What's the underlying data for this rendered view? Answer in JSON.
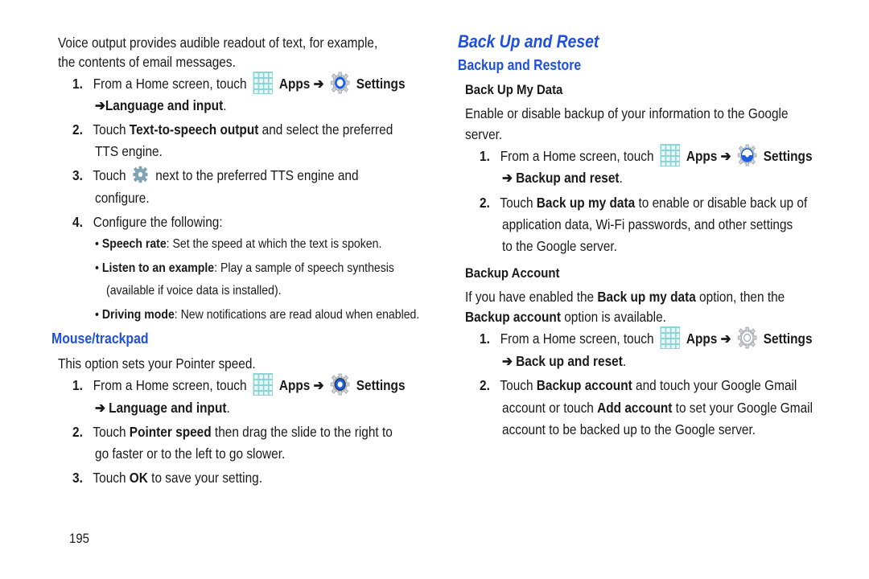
{
  "left": {
    "intro_line1": "Voice output provides audible readout of text, for example,",
    "intro_line2": "the contents of email messages.",
    "steps_a": [
      {
        "num": "1.",
        "pre": "From a Home screen, touch",
        "apps": "Apps",
        "arrow": "➔",
        "settings": "Settings",
        "line2": "➔Language and input",
        "line2_end": "."
      },
      {
        "num": "2.",
        "pre": "Touch ",
        "bold": "Text-to-speech output",
        "post": " and select the preferred",
        "line2": "TTS engine."
      },
      {
        "num": "3.",
        "pre": "Touch",
        "post": "next to the preferred TTS engine and",
        "line2": "configure."
      },
      {
        "num": "4.",
        "text": "Configure the following:"
      }
    ],
    "bullets": [
      {
        "bold": "Speech rate",
        "text": ": Set the speed at which the text is spoken."
      },
      {
        "bold": "Listen to an example",
        "text": ": Play a sample of speech synthesis",
        "line2": "(available if voice data is installed)."
      },
      {
        "bold": "Driving mode",
        "text": ": New notifications are read aloud when enabled."
      }
    ],
    "mouse_heading": "Mouse/trackpad",
    "mouse_intro": "This option sets your Pointer speed.",
    "steps_b": [
      {
        "num": "1.",
        "pre": "From a Home screen, touch",
        "apps": "Apps",
        "arrow": "➔",
        "settings": "Settings",
        "line2": "➔ Language and input",
        "line2_end": "."
      },
      {
        "num": "2.",
        "pre": "Touch ",
        "bold": "Pointer speed",
        "post": " then drag the slide to the right to",
        "line2": "go faster or to the left to go slower."
      },
      {
        "num": "3.",
        "pre": "Touch ",
        "bold": "OK",
        "post": " to save your setting."
      }
    ],
    "page_number": "195"
  },
  "right": {
    "heading": "Back Up and Reset",
    "subheading": "Backup and Restore",
    "section1_title": "Back Up My Data",
    "section1_intro_line1": "Enable or disable backup of your information to the Google",
    "section1_intro_line2": "server.",
    "steps_c": [
      {
        "num": "1.",
        "pre": "From a Home screen, touch",
        "apps": "Apps",
        "arrow": "➔",
        "settings": "Settings",
        "line2": "➔ Backup and reset",
        "line2_end": "."
      },
      {
        "num": "2.",
        "pre": "Touch ",
        "bold": "Back up my data",
        "post": " to enable or disable back up of",
        "line2": "application data, Wi-Fi passwords, and other settings",
        "line3": "to the Google server."
      }
    ],
    "section2_title": "Backup Account",
    "section2_pre": "If you have enabled the ",
    "section2_bold1": "Back up my data",
    "section2_post1": " option, then the",
    "section2_bold2": "Backup account",
    "section2_post2": " option is available.",
    "steps_d": [
      {
        "num": "1.",
        "pre": "From a Home screen, touch",
        "apps": "Apps",
        "arrow": "➔",
        "settings": "Settings",
        "line2": "➔ Back up and reset",
        "line2_end": "."
      },
      {
        "num": "2.",
        "pre": "Touch ",
        "bold": "Backup account",
        "post": " and touch your Google Gmail",
        "line2_pre": "account or touch ",
        "line2_bold": "Add account",
        "line2_post": " to set your Google Gmail",
        "line3": "account to be backed up to the Google server."
      }
    ]
  },
  "colors": {
    "heading_blue": "#1f4fe0",
    "apps_icon": "#7fcfd0",
    "settings_blue": "#1d5fe0"
  }
}
